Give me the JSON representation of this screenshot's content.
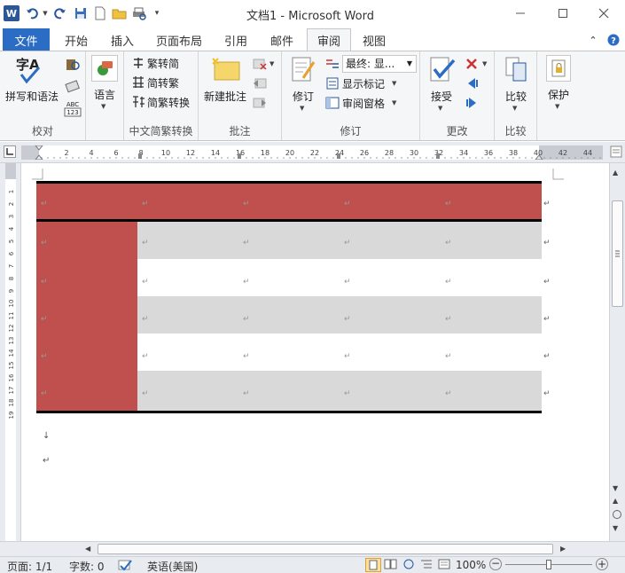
{
  "window": {
    "title": "文档1 - Microsoft Word",
    "logo": "W"
  },
  "tabs": {
    "file": "文件",
    "items": [
      "开始",
      "插入",
      "页面布局",
      "引用",
      "邮件",
      "审阅",
      "视图"
    ],
    "active": "审阅"
  },
  "ribbon": {
    "proofing": {
      "spelling_icon_text": "字A",
      "spelling_label": "拼写和语法",
      "abc_badge_top": "ABC",
      "abc_badge_bottom": "123",
      "group_label": "校对"
    },
    "language": {
      "label": "语言",
      "group_label": ""
    },
    "chinese": {
      "to_simplified": "繁转简",
      "to_traditional": "简转繁",
      "convert": "简繁转换",
      "group_label": "中文简繁转换"
    },
    "comments": {
      "new_comment": "新建批注",
      "group_label": "批注"
    },
    "tracking": {
      "track_changes": "修订",
      "final_value": "最终: 显...",
      "show_markup": "显示标记",
      "reviewing_pane": "审阅窗格",
      "group_label": "修订"
    },
    "changes": {
      "accept": "接受",
      "group_label": "更改"
    },
    "compare": {
      "compare": "比较",
      "group_label": "比较"
    },
    "protect": {
      "protect": "保护",
      "group_label": ""
    }
  },
  "ruler": {
    "labels": [
      "2",
      "4",
      "6",
      "8",
      "10",
      "12",
      "14",
      "16",
      "18",
      "20",
      "22",
      "24",
      "26",
      "28",
      "30",
      "32",
      "34",
      "36",
      "38",
      "40",
      "42",
      "44"
    ]
  },
  "vruler": {
    "labels": [
      "1",
      "2",
      "3",
      "4",
      "5",
      "6",
      "7",
      "8",
      "9",
      "10",
      "11",
      "12",
      "13",
      "14",
      "15",
      "16",
      "17",
      "18",
      "19"
    ]
  },
  "document": {
    "paragraph_mark": "↵",
    "line_break_mark": "↓",
    "table_rows": 6,
    "table_cols": 5
  },
  "colors": {
    "accent_red": "#c0504d",
    "row_gray": "#d9d9d9",
    "file_tab": "#2b6cc4"
  },
  "statusbar": {
    "page": "页面: 1/1",
    "words": "字数: 0",
    "language": "英语(美国)",
    "zoom": "100%",
    "zoom_minus": "−",
    "zoom_plus": "+"
  }
}
